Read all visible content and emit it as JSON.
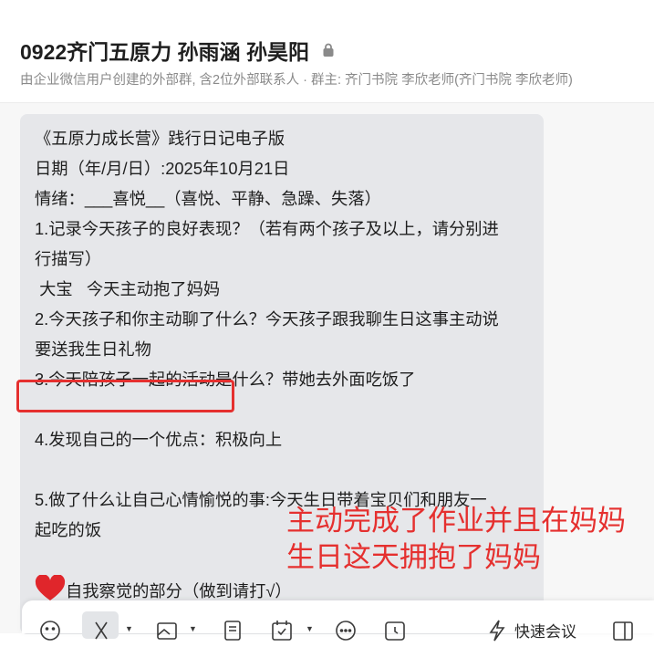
{
  "header": {
    "title": "0922齐门五原力 孙雨涵 孙昊阳",
    "subtitle": "由企业微信用户创建的外部群, 含2位外部联系人 · 群主: 齐门书院 李欣老师(齐门书院 李欣老师)"
  },
  "message": {
    "lines": [
      "《五原力成长营》践行日记电子版",
      "日期（年/月/日）:2025年10月21日",
      "情绪：___喜悦__（喜悦、平静、急躁、失落）",
      "1.记录今天孩子的良好表现？（若有两个孩子及以上，请分别进",
      "行描写）",
      " 大宝   今天主动抱了妈妈",
      "2.今天孩子和你主动聊了什么？今天孩子跟我聊生日这事主动说",
      "要送我生日礼物",
      "3.今天陪孩子一起的活动是什么？带她去外面吃饭了",
      "",
      "4.发现自己的一个优点：积极向上",
      "",
      "5.做了什么让自己心情愉悦的事:今天生日带着宝贝们和朋友一",
      "起吃的饭",
      "",
      "自我察觉的部分（做到请打√）"
    ]
  },
  "annotation": {
    "line1": "主动完成了作业并且在妈妈",
    "line2": "生日这天拥抱了妈妈"
  },
  "toolbar": {
    "icons": [
      "emoji-icon",
      "scissors-icon",
      "image-icon",
      "document-icon",
      "calendar-icon",
      "chat-bubble-icon",
      "clock-icon",
      "lightning-icon",
      "window-icon"
    ],
    "quick_meeting_label": "快速会议"
  },
  "colors": {
    "annotation_red": "#e5302f",
    "bubble_bg": "#e6e7ea"
  }
}
